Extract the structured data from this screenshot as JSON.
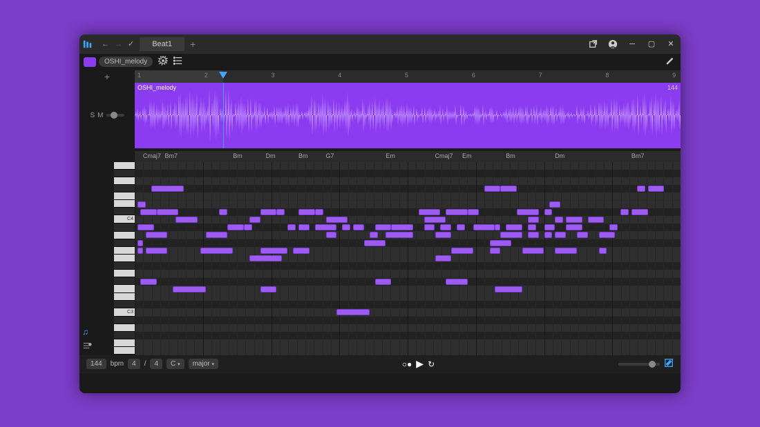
{
  "titlebar": {
    "tab": "Beat1"
  },
  "track": {
    "name": "OSHI_melody",
    "clip_label": "OSHI_melody",
    "bpm_badge": "144",
    "solo": "S",
    "mute": "M"
  },
  "ruler": {
    "marks": [
      "1",
      "2",
      "3",
      "4",
      "5",
      "6",
      "7",
      "8",
      "9"
    ],
    "playhead_pct": 16.2,
    "highlight_start_pct": 0,
    "highlight_end_pct": 16.2
  },
  "chords": [
    {
      "pos": 1.5,
      "name": "Cmaj7"
    },
    {
      "pos": 5.5,
      "name": "Bm7"
    },
    {
      "pos": 18,
      "name": "Bm"
    },
    {
      "pos": 24,
      "name": "Dm"
    },
    {
      "pos": 30,
      "name": "Bm"
    },
    {
      "pos": 35,
      "name": "G7"
    },
    {
      "pos": 46,
      "name": "Em"
    },
    {
      "pos": 55,
      "name": "Cmaj7"
    },
    {
      "pos": 60,
      "name": "Em"
    },
    {
      "pos": 68,
      "name": "Bm"
    },
    {
      "pos": 77,
      "name": "Dm"
    },
    {
      "pos": 91,
      "name": "Bm7"
    }
  ],
  "piano": {
    "keys": [
      "w",
      "b",
      "w",
      "b",
      "w",
      "w",
      "b",
      "w",
      "b",
      "w",
      "b",
      "w",
      "w",
      "b",
      "w",
      "b",
      "w",
      "w",
      "b",
      "w",
      "b",
      "w",
      "b",
      "w",
      "w"
    ],
    "labels": {
      "7": "C4",
      "19": "C3"
    }
  },
  "notes": [
    {
      "r": 3,
      "s": 3,
      "w": 6
    },
    {
      "r": 3,
      "s": 64,
      "w": 3
    },
    {
      "r": 3,
      "s": 67,
      "w": 3
    },
    {
      "r": 3,
      "s": 92,
      "w": 1.5
    },
    {
      "r": 3,
      "s": 94,
      "w": 3
    },
    {
      "r": 5,
      "s": 0.5,
      "w": 1.5
    },
    {
      "r": 5,
      "s": 76,
      "w": 2
    },
    {
      "r": 6,
      "s": 1,
      "w": 3
    },
    {
      "r": 6,
      "s": 4,
      "w": 4
    },
    {
      "r": 6,
      "s": 15.5,
      "w": 1.5
    },
    {
      "r": 6,
      "s": 23,
      "w": 3
    },
    {
      "r": 6,
      "s": 26,
      "w": 1.5
    },
    {
      "r": 6,
      "s": 30,
      "w": 3
    },
    {
      "r": 6,
      "s": 33,
      "w": 1.5
    },
    {
      "r": 6,
      "s": 52,
      "w": 4
    },
    {
      "r": 6,
      "s": 57,
      "w": 4
    },
    {
      "r": 6,
      "s": 61,
      "w": 2
    },
    {
      "r": 6,
      "s": 70,
      "w": 4
    },
    {
      "r": 6,
      "s": 75,
      "w": 1.5
    },
    {
      "r": 6,
      "s": 89,
      "w": 1.5
    },
    {
      "r": 6,
      "s": 91,
      "w": 3
    },
    {
      "r": 7,
      "s": 7.5,
      "w": 4
    },
    {
      "r": 7,
      "s": 21,
      "w": 2
    },
    {
      "r": 7,
      "s": 35,
      "w": 4
    },
    {
      "r": 7,
      "s": 53,
      "w": 4
    },
    {
      "r": 7,
      "s": 72,
      "w": 2
    },
    {
      "r": 7,
      "s": 77,
      "w": 1.5
    },
    {
      "r": 7,
      "s": 79,
      "w": 3
    },
    {
      "r": 7,
      "s": 83,
      "w": 3
    },
    {
      "r": 8,
      "s": 0.5,
      "w": 3
    },
    {
      "r": 8,
      "s": 17,
      "w": 3
    },
    {
      "r": 8,
      "s": 20,
      "w": 1.5
    },
    {
      "r": 8,
      "s": 28,
      "w": 1.5
    },
    {
      "r": 8,
      "s": 30,
      "w": 2
    },
    {
      "r": 8,
      "s": 33,
      "w": 4
    },
    {
      "r": 8,
      "s": 38,
      "w": 1.5
    },
    {
      "r": 8,
      "s": 40,
      "w": 2
    },
    {
      "r": 8,
      "s": 44,
      "w": 3
    },
    {
      "r": 8,
      "s": 47,
      "w": 4
    },
    {
      "r": 8,
      "s": 53,
      "w": 2
    },
    {
      "r": 8,
      "s": 56,
      "w": 2
    },
    {
      "r": 8,
      "s": 59,
      "w": 1.5
    },
    {
      "r": 8,
      "s": 62,
      "w": 4
    },
    {
      "r": 8,
      "s": 66,
      "w": 1
    },
    {
      "r": 8,
      "s": 68,
      "w": 3
    },
    {
      "r": 8,
      "s": 72,
      "w": 1.5
    },
    {
      "r": 8,
      "s": 75,
      "w": 2
    },
    {
      "r": 8,
      "s": 79,
      "w": 3
    },
    {
      "r": 8,
      "s": 87,
      "w": 1.5
    },
    {
      "r": 9,
      "s": 2,
      "w": 4
    },
    {
      "r": 9,
      "s": 13,
      "w": 4
    },
    {
      "r": 9,
      "s": 35,
      "w": 2
    },
    {
      "r": 9,
      "s": 43,
      "w": 1.5
    },
    {
      "r": 9,
      "s": 46,
      "w": 5
    },
    {
      "r": 9,
      "s": 55,
      "w": 3
    },
    {
      "r": 9,
      "s": 67,
      "w": 4
    },
    {
      "r": 9,
      "s": 72,
      "w": 2
    },
    {
      "r": 9,
      "s": 75,
      "w": 1.5
    },
    {
      "r": 9,
      "s": 77,
      "w": 2
    },
    {
      "r": 9,
      "s": 81,
      "w": 2
    },
    {
      "r": 9,
      "s": 85,
      "w": 3
    },
    {
      "r": 10,
      "s": 0.5,
      "w": 1
    },
    {
      "r": 10,
      "s": 42,
      "w": 4
    },
    {
      "r": 10,
      "s": 65,
      "w": 4
    },
    {
      "r": 11,
      "s": 0.5,
      "w": 1
    },
    {
      "r": 11,
      "s": 2,
      "w": 4
    },
    {
      "r": 11,
      "s": 12,
      "w": 6
    },
    {
      "r": 11,
      "s": 23,
      "w": 5
    },
    {
      "r": 11,
      "s": 29,
      "w": 3
    },
    {
      "r": 11,
      "s": 58,
      "w": 4
    },
    {
      "r": 11,
      "s": 65,
      "w": 2
    },
    {
      "r": 11,
      "s": 71,
      "w": 4
    },
    {
      "r": 11,
      "s": 77,
      "w": 4
    },
    {
      "r": 11,
      "s": 85,
      "w": 1.5
    },
    {
      "r": 12,
      "s": 21,
      "w": 6
    },
    {
      "r": 12,
      "s": 55,
      "w": 3
    },
    {
      "r": 15,
      "s": 1,
      "w": 3
    },
    {
      "r": 15,
      "s": 44,
      "w": 3
    },
    {
      "r": 15,
      "s": 57,
      "w": 4
    },
    {
      "r": 16,
      "s": 7,
      "w": 6
    },
    {
      "r": 16,
      "s": 23,
      "w": 3
    },
    {
      "r": 16,
      "s": 66,
      "w": 5
    },
    {
      "r": 19,
      "s": 37,
      "w": 6
    }
  ],
  "bottombar": {
    "bpm": "144",
    "bpm_label": "bpm",
    "sig_num": "4",
    "sig_den": "4",
    "sig_sep": "/",
    "key": "C",
    "scale": "major"
  }
}
